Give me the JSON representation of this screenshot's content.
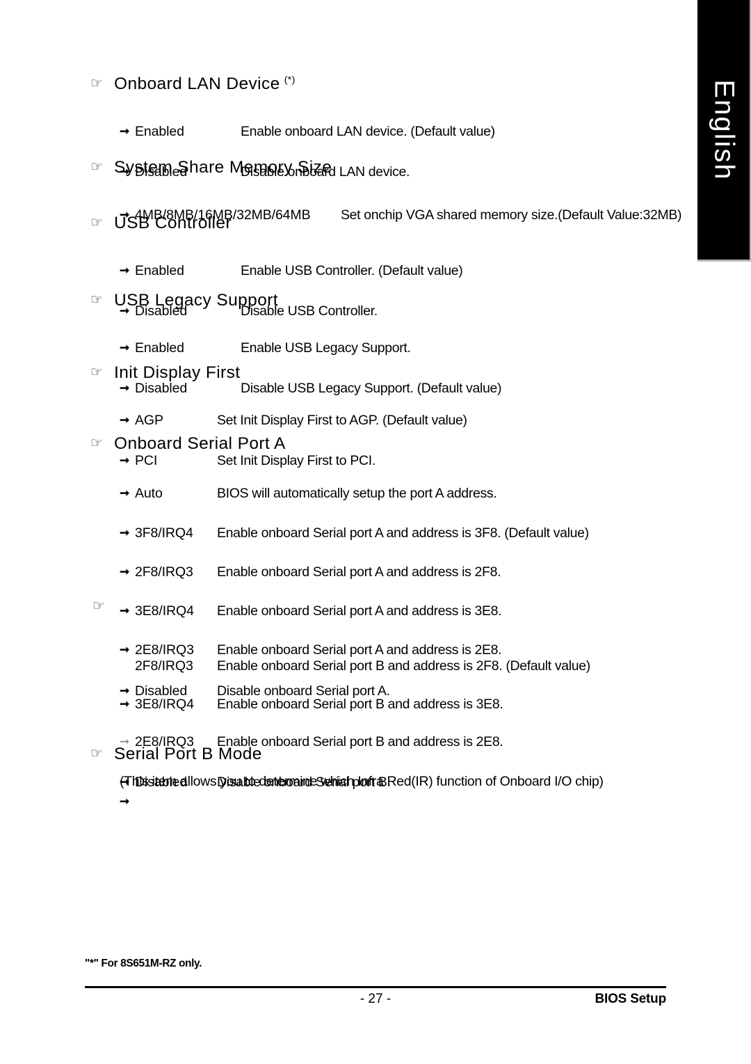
{
  "page": {
    "language_tab": "English",
    "page_number": "- 27 -",
    "footer_right": "BIOS Setup",
    "footnote": "\"*\" For 8S651M-RZ only."
  },
  "icons": {
    "hand": "hand-pointing-icon",
    "bullet": "double-arrow-bullet-icon"
  },
  "sections": [
    {
      "title": "Onboard LAN Device",
      "superscript": "(*)",
      "options": [
        {
          "label": "Enabled",
          "desc": "Enable onboard LAN device. (Default value)"
        },
        {
          "label": "Disabled",
          "desc": "Disable onboard LAN device."
        }
      ]
    },
    {
      "title": "System Share Memory Size",
      "superscript": "",
      "options": [
        {
          "label": "4MB/8MB/16MB/32MB/64MB",
          "desc": "Set onchip VGA shared memory size.(Default Value:32MB)"
        }
      ]
    },
    {
      "title": "USB Controller",
      "superscript": "",
      "options": [
        {
          "label": "Enabled",
          "desc": "Enable USB Controller. (Default value)"
        },
        {
          "label": "Disabled",
          "desc": "Disable USB Controller."
        }
      ]
    },
    {
      "title": "USB Legacy Support",
      "superscript": "",
      "options": [
        {
          "label": "Enabled",
          "desc": "Enable USB Legacy Support."
        },
        {
          "label": "Disabled",
          "desc": "Disable USB Legacy Support. (Default value)"
        }
      ]
    },
    {
      "title": "Init Display First",
      "superscript": "",
      "options": [
        {
          "label": "AGP",
          "desc": "Set Init Display First to AGP. (Default value)"
        },
        {
          "label": "PCI",
          "desc": "Set Init Display First to PCI."
        }
      ]
    },
    {
      "title": "Onboard Serial Port A",
      "superscript": "",
      "options": [
        {
          "label": "Auto",
          "desc": "BIOS will automatically setup the port A address."
        },
        {
          "label": "3F8/IRQ4",
          "desc": "Enable onboard Serial port A and address is 3F8. (Default value)"
        },
        {
          "label": "2F8/IRQ3",
          "desc": "Enable onboard Serial port A and address is 2F8."
        },
        {
          "label": "3E8/IRQ4",
          "desc": "Enable onboard Serial port A and address is 3E8."
        },
        {
          "label": "2E8/IRQ3",
          "desc": "Enable onboard Serial port A and address is 2E8."
        },
        {
          "label": "Disabled",
          "desc": "Disable onboard Serial port A."
        }
      ]
    },
    {
      "title": "",
      "superscript": "",
      "options": [
        {
          "label": "2F8/IRQ3",
          "desc": "Enable onboard Serial port B and address is 2F8. (Default value)"
        },
        {
          "label": "3E8/IRQ4",
          "desc": "Enable onboard Serial port B and address is 3E8."
        },
        {
          "label": "2E8/IRQ3",
          "desc": "Enable onboard Serial port B and address is 2E8."
        },
        {
          "label": "Disabled",
          "desc": "Disable onboard Serial port B."
        }
      ]
    },
    {
      "title": "Serial Port B Mode",
      "superscript": "",
      "note": "(This item allows you to determine which Infra Red(IR) function of Onboard I/O chip)",
      "options": []
    }
  ]
}
